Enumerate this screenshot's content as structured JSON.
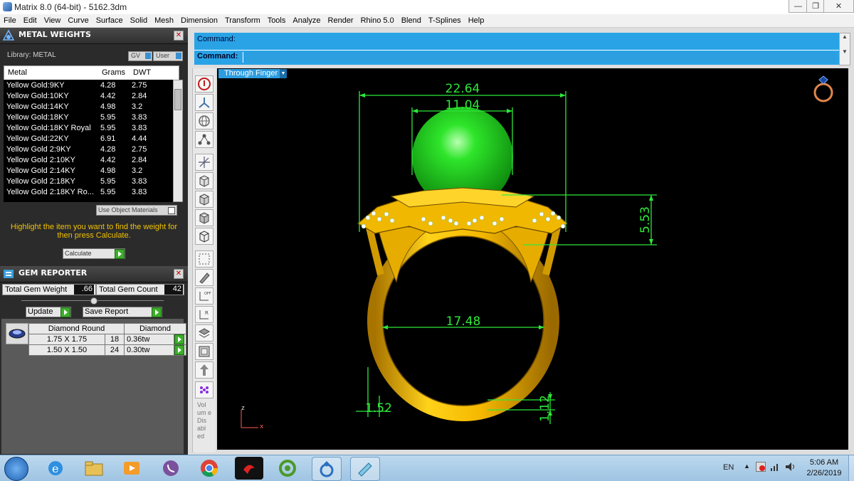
{
  "window": {
    "title": "Matrix 8.0 (64-bit) - 5162.3dm"
  },
  "menu": [
    "File",
    "Edit",
    "View",
    "Curve",
    "Surface",
    "Solid",
    "Mesh",
    "Dimension",
    "Transform",
    "Tools",
    "Analyze",
    "Render",
    "Rhino 5.0",
    "Blend",
    "T-Splines",
    "Help"
  ],
  "metal_weights": {
    "title": "METAL WEIGHTS",
    "library_label": "Library: METAL",
    "gv_label": "GV",
    "user_label": "User",
    "columns": [
      "Metal",
      "Grams",
      "DWT"
    ],
    "rows": [
      {
        "metal": "Yellow Gold:9KY",
        "grams": "4.28",
        "dwt": "2.75"
      },
      {
        "metal": "Yellow Gold:10KY",
        "grams": "4.42",
        "dwt": "2.84"
      },
      {
        "metal": "Yellow Gold:14KY",
        "grams": "4.98",
        "dwt": "3.2"
      },
      {
        "metal": "Yellow Gold:18KY",
        "grams": "5.95",
        "dwt": "3.83"
      },
      {
        "metal": "Yellow Gold:18KY Royal",
        "grams": "5.95",
        "dwt": "3.83"
      },
      {
        "metal": "Yellow Gold:22KY",
        "grams": "6.91",
        "dwt": "4.44"
      },
      {
        "metal": "Yellow Gold 2:9KY",
        "grams": "4.28",
        "dwt": "2.75"
      },
      {
        "metal": "Yellow Gold 2:10KY",
        "grams": "4.42",
        "dwt": "2.84"
      },
      {
        "metal": "Yellow Gold 2:14KY",
        "grams": "4.98",
        "dwt": "3.2"
      },
      {
        "metal": "Yellow Gold 2:18KY",
        "grams": "5.95",
        "dwt": "3.83"
      },
      {
        "metal": "Yellow Gold 2:18KY Ro...",
        "grams": "5.95",
        "dwt": "3.83"
      }
    ],
    "use_object_materials": "Use Object Materials",
    "instruction": "Highlight the item you want to find the weight for then press Calculate.",
    "calculate_label": "Calculate"
  },
  "gem_reporter": {
    "title": "GEM REPORTER",
    "total_weight_label": "Total Gem Weight",
    "total_weight_value": ".66",
    "total_count_label": "Total Gem Count",
    "total_count_value": "42",
    "update_label": "Update",
    "save_report_label": "Save Report",
    "shape": "Diamond Round",
    "material": "Diamond",
    "rows": [
      {
        "size": "1.75 X 1.75",
        "count": "18",
        "weight": "0.36tw"
      },
      {
        "size": "1.50 X 1.50",
        "count": "24",
        "weight": "0.30tw"
      }
    ]
  },
  "command": {
    "line1": "Command:",
    "line2_label": "Command:"
  },
  "viewport": {
    "dropdown": "Through Finger",
    "dimensions": [
      "22.64",
      "11.04",
      "5.53",
      "17.48",
      "1.52",
      "1.12"
    ],
    "axis_z": "z",
    "axis_x": "x"
  },
  "toolbar": {
    "volume_text": "Vol um e Dis abl ed"
  },
  "taskbar": {
    "lang": "EN",
    "time": "5:06 AM",
    "date": "2/26/2019",
    "apps": [
      "start-orb-icon",
      "ie-icon",
      "file-explorer-icon",
      "media-player-icon",
      "viber-icon",
      "chrome-icon",
      "game-app-icon",
      "cleaner-icon",
      "matrix-app-icon",
      "notes-app-icon"
    ]
  },
  "colors": {
    "command_blue": "#29a3e6",
    "gold": "#f5c400",
    "pearl": "#19d41c",
    "dim_green": "#2ee83a"
  }
}
